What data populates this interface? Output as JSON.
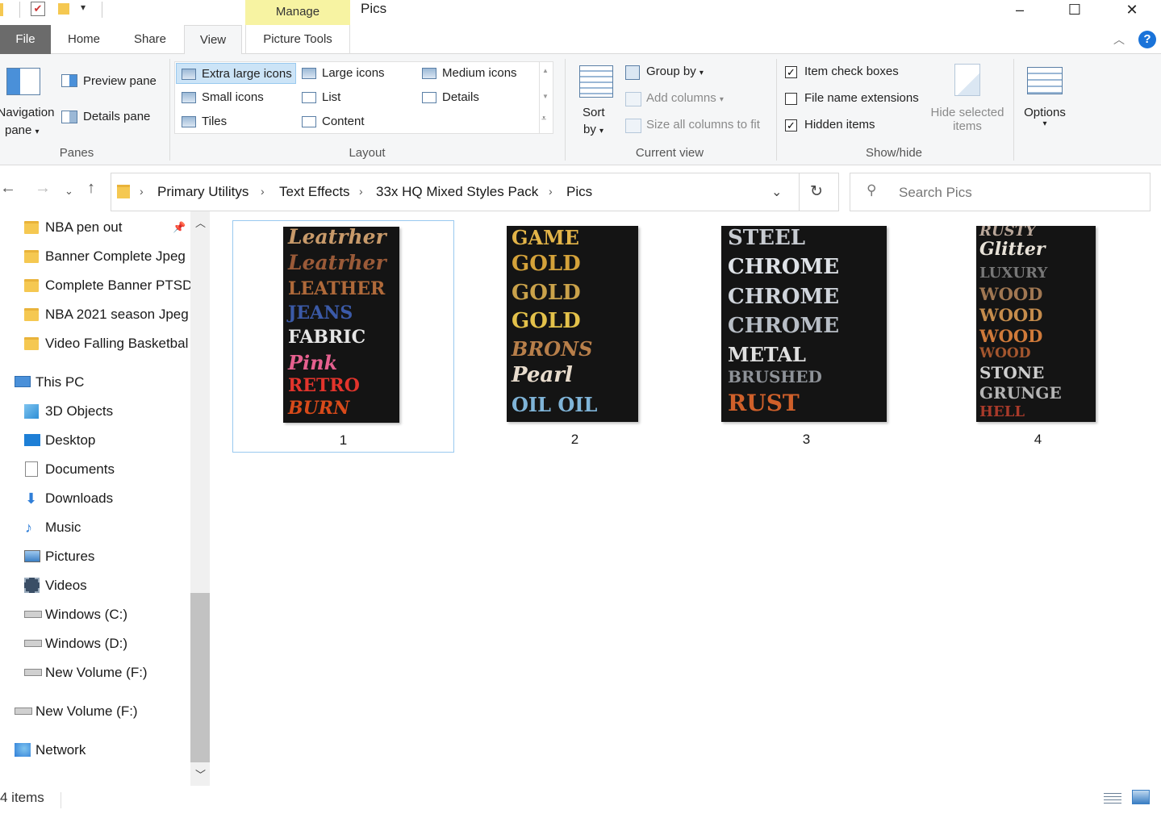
{
  "window": {
    "title": "Pics",
    "manage_tab": "Manage",
    "controls": {
      "minimize": "–",
      "maximize": "☐",
      "close": "✕"
    }
  },
  "tabs": {
    "file": "File",
    "home": "Home",
    "share": "Share",
    "view": "View",
    "picture_tools": "Picture Tools"
  },
  "ribbon": {
    "panes": {
      "navigation_pane_line1": "Navigation",
      "navigation_pane_line2": "pane",
      "preview_pane": "Preview pane",
      "details_pane": "Details pane",
      "group_label": "Panes"
    },
    "layout": {
      "extra_large_icons": "Extra large icons",
      "large_icons": "Large icons",
      "medium_icons": "Medium icons",
      "small_icons": "Small icons",
      "list": "List",
      "details": "Details",
      "tiles": "Tiles",
      "content": "Content",
      "group_label": "Layout",
      "selected": "Extra large icons"
    },
    "current_view": {
      "sort_by_line1": "Sort",
      "sort_by_line2": "by",
      "group_by": "Group by",
      "add_columns": "Add columns",
      "size_all_columns": "Size all columns to fit",
      "group_label": "Current view"
    },
    "show_hide": {
      "item_check_boxes": "Item check boxes",
      "item_check_boxes_checked": true,
      "file_name_extensions": "File name extensions",
      "file_name_extensions_checked": false,
      "hidden_items": "Hidden items",
      "hidden_items_checked": true,
      "hide_selected_line1": "Hide selected",
      "hide_selected_line2": "items",
      "group_label": "Show/hide"
    },
    "options": "Options"
  },
  "address": {
    "breadcrumbs": [
      "Primary Utilitys",
      "Text Effects",
      "33x HQ Mixed Styles Pack",
      "Pics"
    ],
    "search_placeholder": "Search Pics"
  },
  "navpane": {
    "quick_access": [
      "NBA pen out",
      "Banner Complete Jpeg",
      "Complete Banner PTSD",
      "NBA 2021 season Jpeg",
      "Video Falling Basketbal"
    ],
    "this_pc": "This PC",
    "pc_items": [
      "3D Objects",
      "Desktop",
      "Documents",
      "Downloads",
      "Music",
      "Pictures",
      "Videos",
      "Windows (C:)",
      "Windows (D:)",
      "New Volume (F:)"
    ],
    "new_volume": "New Volume (F:)",
    "network": "Network"
  },
  "files": [
    {
      "name": "1",
      "lines": [
        "Leatrher",
        "Leatrher",
        "LEATHER",
        "JEANS",
        "FABRIC",
        "Pink",
        "RETRO",
        "BURN"
      ]
    },
    {
      "name": "2",
      "lines": [
        "GAME",
        "GOLD",
        "GOLD",
        "GOLD",
        "BRONS",
        "Pearl",
        "OIL OIL"
      ]
    },
    {
      "name": "3",
      "lines": [
        "STEEL",
        "CHROME",
        "CHROME",
        "CHROME",
        "METAL",
        "BRUSHED",
        "RUST"
      ]
    },
    {
      "name": "4",
      "lines": [
        "RUSTY",
        "Glitter",
        "LUXURY",
        "WOOD",
        "WOOD",
        "WOOD",
        "WOOD",
        "STONE",
        "GRUNGE",
        "HELL"
      ]
    }
  ],
  "status": {
    "item_count": "4 items"
  },
  "colors": {
    "manage_tab_bg": "#f7f3a2",
    "selection_bg": "#cce4f7",
    "selection_border": "#99c9ef",
    "file_tab_bg": "#6b6b6b"
  }
}
